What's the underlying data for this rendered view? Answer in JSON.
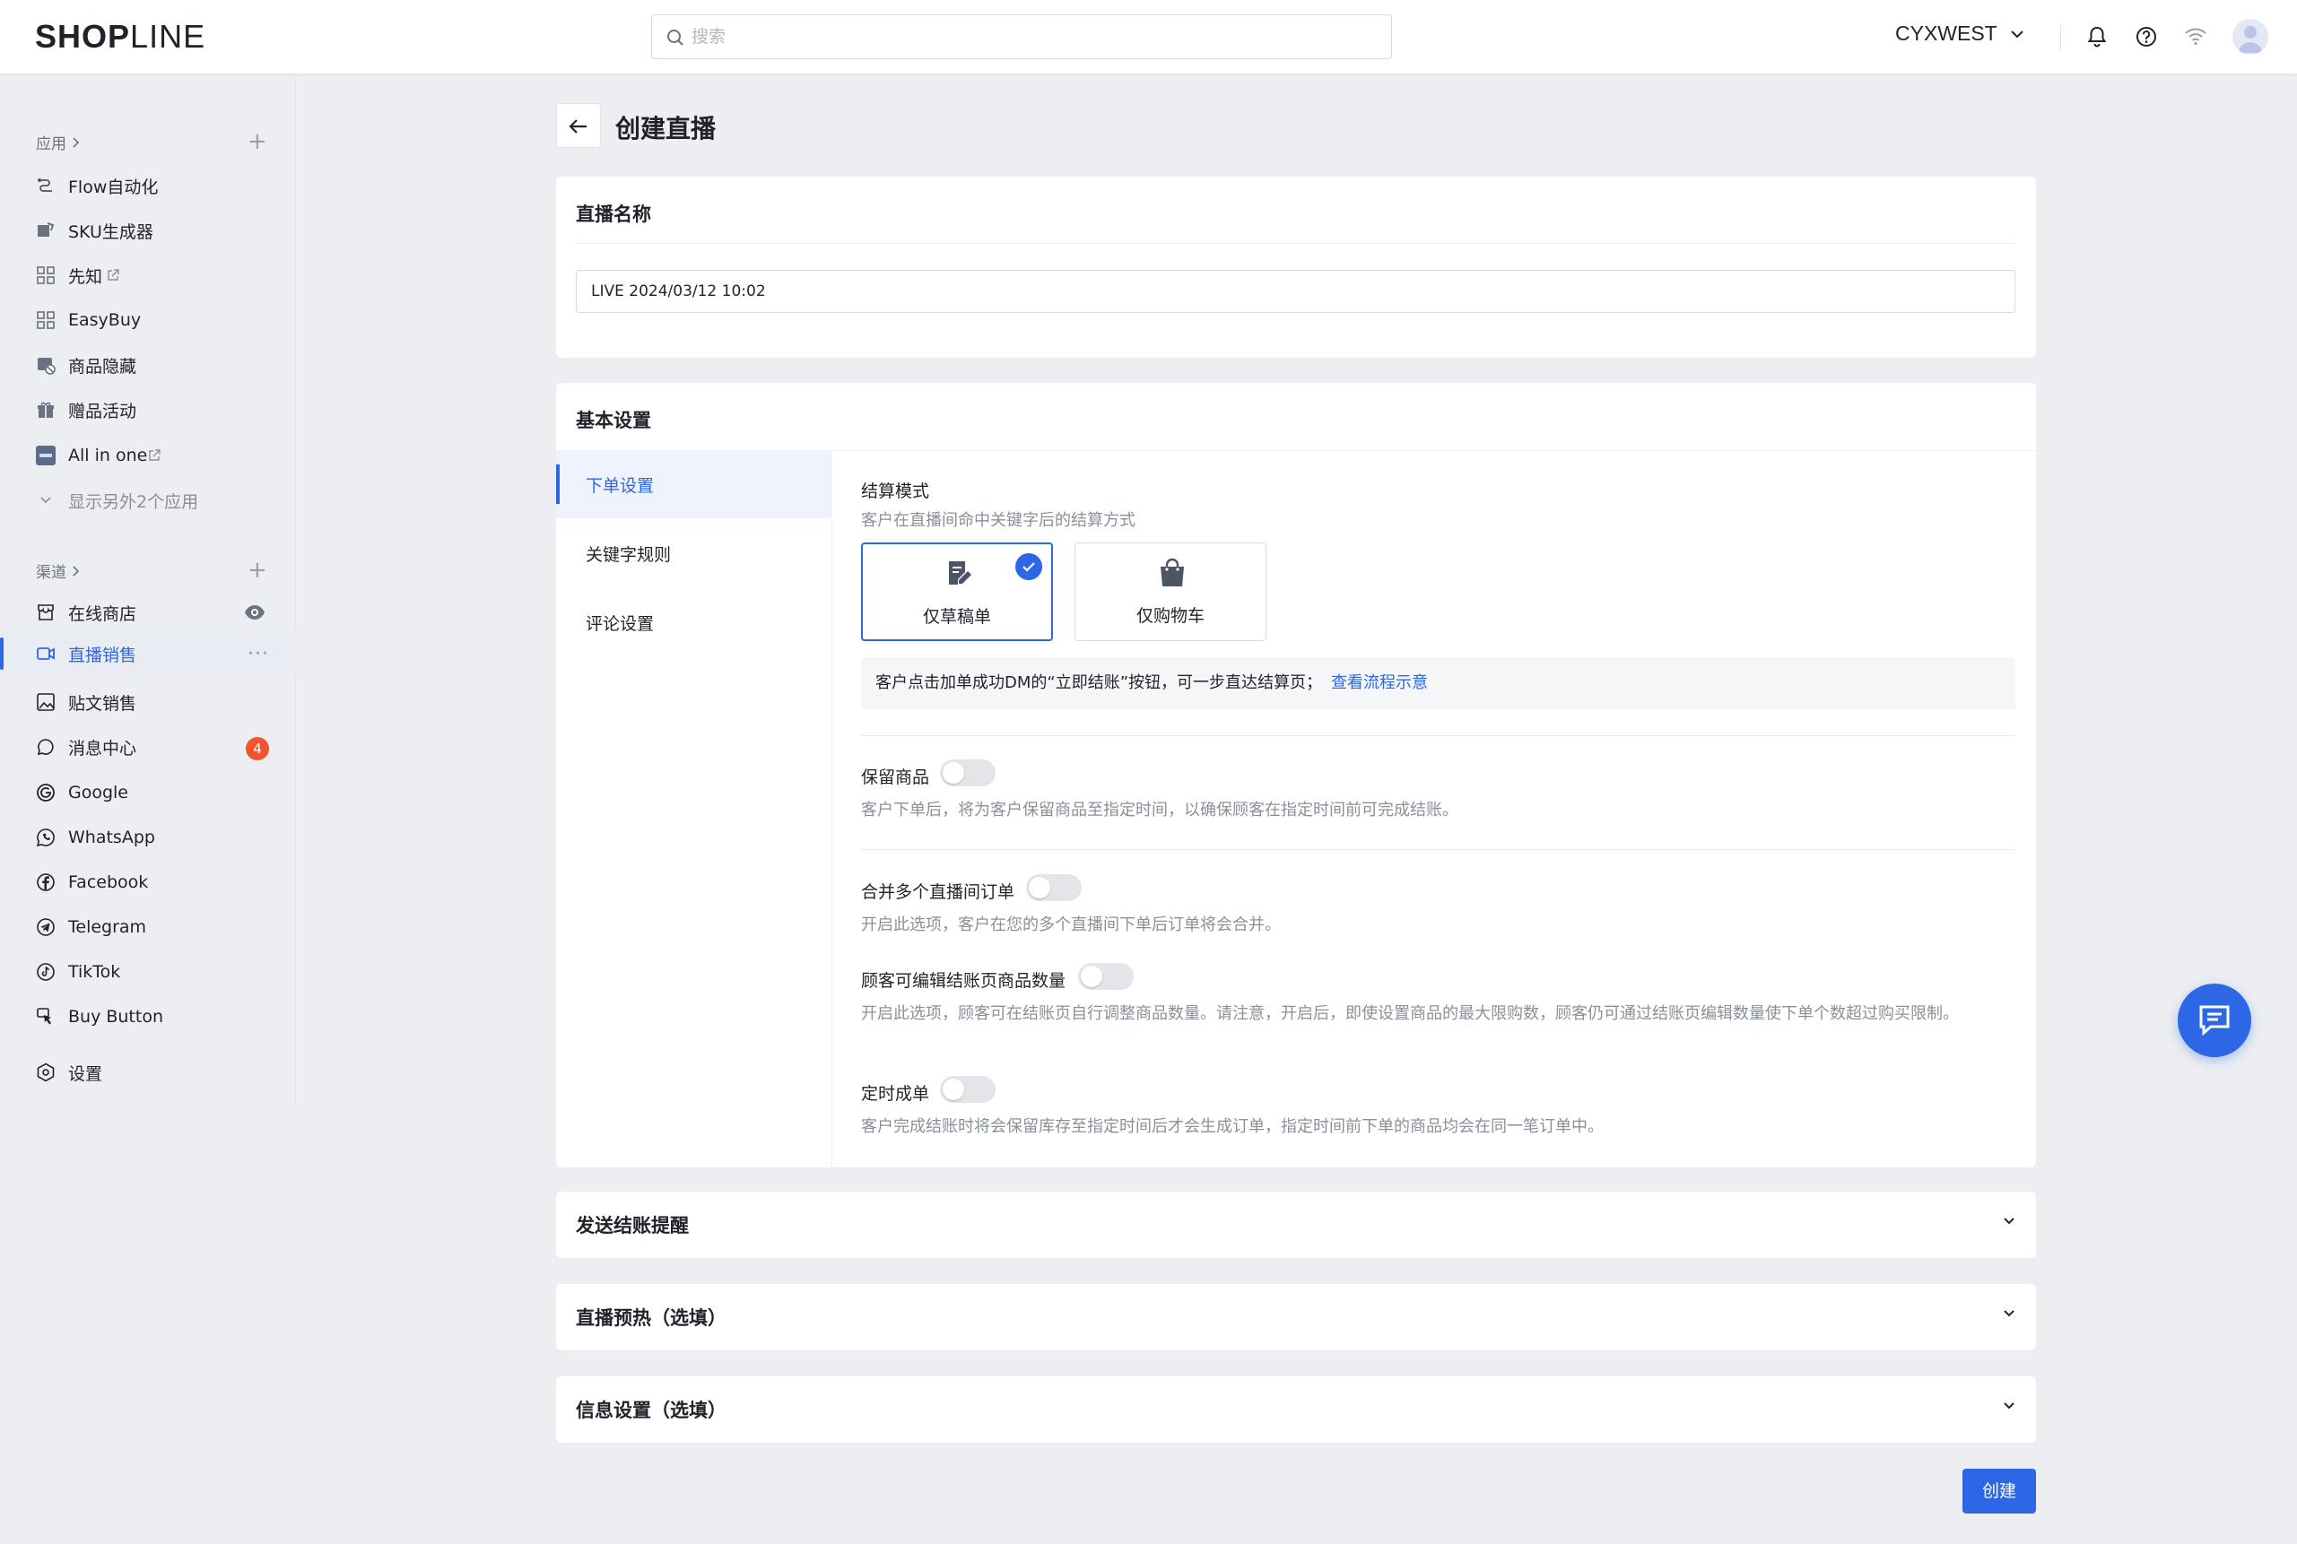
{
  "header": {
    "logo_left": "SH",
    "logo_o": "O",
    "logo_p": "P",
    "logo_right": "LINE",
    "search_placeholder": "搜索",
    "store_name": "CYXWEST"
  },
  "sidebar": {
    "apps_title": "应用",
    "apps": [
      {
        "label": "Flow自动化",
        "icon": "flow-icon"
      },
      {
        "label": "SKU生成器",
        "icon": "sku-icon"
      },
      {
        "label": "先知",
        "icon": "grid-icon"
      },
      {
        "label": "EasyBuy",
        "icon": "grid-icon"
      },
      {
        "label": "商品隐藏",
        "icon": "hide-product-icon"
      },
      {
        "label": "赠品活动",
        "icon": "gift-icon"
      },
      {
        "label": "All in one",
        "icon": "app-logo-icon"
      }
    ],
    "show_more": "显示另外2个应用",
    "channels_title": "渠道",
    "channels": [
      {
        "label": "在线商店",
        "icon": "store-icon"
      },
      {
        "label": "直播销售",
        "icon": "live-icon"
      },
      {
        "label": "贴文销售",
        "icon": "post-icon"
      },
      {
        "label": "消息中心",
        "icon": "message-icon",
        "badge": "4"
      },
      {
        "label": "Google",
        "icon": "google-icon"
      },
      {
        "label": "WhatsApp",
        "icon": "whatsapp-icon"
      },
      {
        "label": "Facebook",
        "icon": "facebook-icon"
      },
      {
        "label": "Telegram",
        "icon": "telegram-icon"
      },
      {
        "label": "TikTok",
        "icon": "tiktok-icon"
      },
      {
        "label": "Buy Button",
        "icon": "buy-button-icon"
      }
    ],
    "settings": "设置",
    "more_dots": "···"
  },
  "page": {
    "title": "创建直播",
    "name_card": {
      "title": "直播名称",
      "value": "LIVE 2024/03/12 10:02"
    },
    "basic": {
      "title": "基本设置",
      "tabs": [
        "下单设置",
        "关键字规则",
        "评论设置"
      ],
      "checkout_mode_label": "结算模式",
      "checkout_mode_desc": "客户在直播间命中关键字后的结算方式",
      "options": [
        "仅草稿单",
        "仅购物车"
      ],
      "notice_text": "客户点击加单成功DM的“立即结账”按钮，可一步直达结算页；",
      "notice_link": "查看流程示意",
      "reserve_label": "保留商品",
      "reserve_desc": "客户下单后，将为客户保留商品至指定时间，以确保顾客在指定时间前可完成结账。",
      "merge_label": "合并多个直播间订单",
      "merge_desc": "开启此选项，客户在您的多个直播间下单后订单将会合并。",
      "edit_qty_label": "顾客可编辑结账页商品数量",
      "edit_qty_desc": "开启此选项，顾客可在结账页自行调整商品数量。请注意，开启后，即使设置商品的最大限购数，顾客仍可通过结账页编辑数量使下单个数超过购买限制。",
      "timed_label": "定时成单",
      "timed_desc": "客户完成结账时将会保留库存至指定时间后才会生成订单，指定时间前下单的商品均会在同一笔订单中。"
    },
    "collapsed": [
      "发送结账提醒",
      "直播预热（选填）",
      "信息设置（选填）"
    ],
    "create_button": "创建"
  },
  "colors": {
    "accent": "#2e67e6",
    "badge": "#f2542d",
    "background": "#eceef2"
  }
}
